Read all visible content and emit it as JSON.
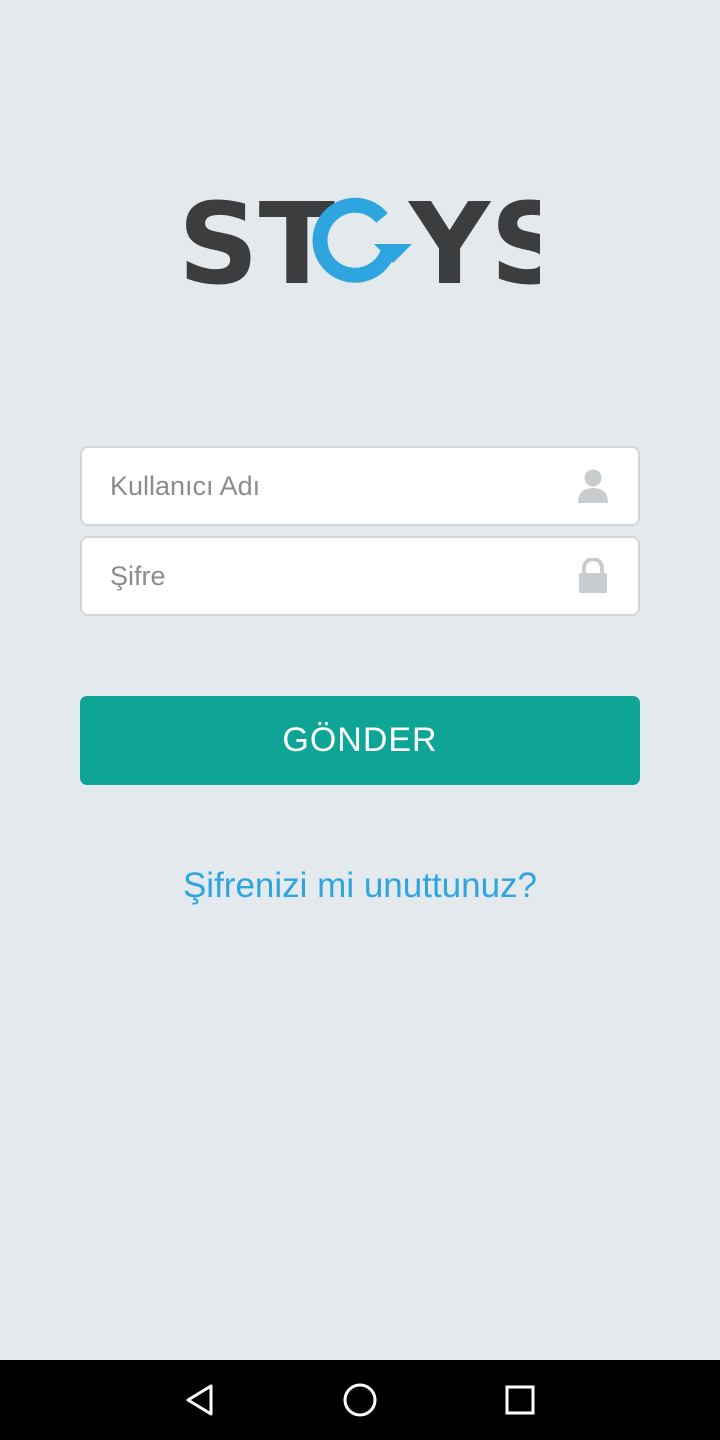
{
  "logo": {
    "text": "STOYS",
    "colors": {
      "dark": "#3b3d3f",
      "accent": "#2ea5df"
    }
  },
  "login": {
    "username_placeholder": "Kullanıcı Adı",
    "username_icon": "user-icon",
    "password_placeholder": "Şifre",
    "password_icon": "lock-icon",
    "submit_label": "GÖNDER",
    "forgot_label": "Şifrenizi mi unuttunuz?"
  },
  "colors": {
    "background": "#e4e9ed",
    "button": "#0ea597",
    "link": "#2ea5df"
  },
  "navbar": {
    "back_icon": "back-triangle-icon",
    "home_icon": "home-circle-icon",
    "recent_icon": "recent-square-icon"
  }
}
